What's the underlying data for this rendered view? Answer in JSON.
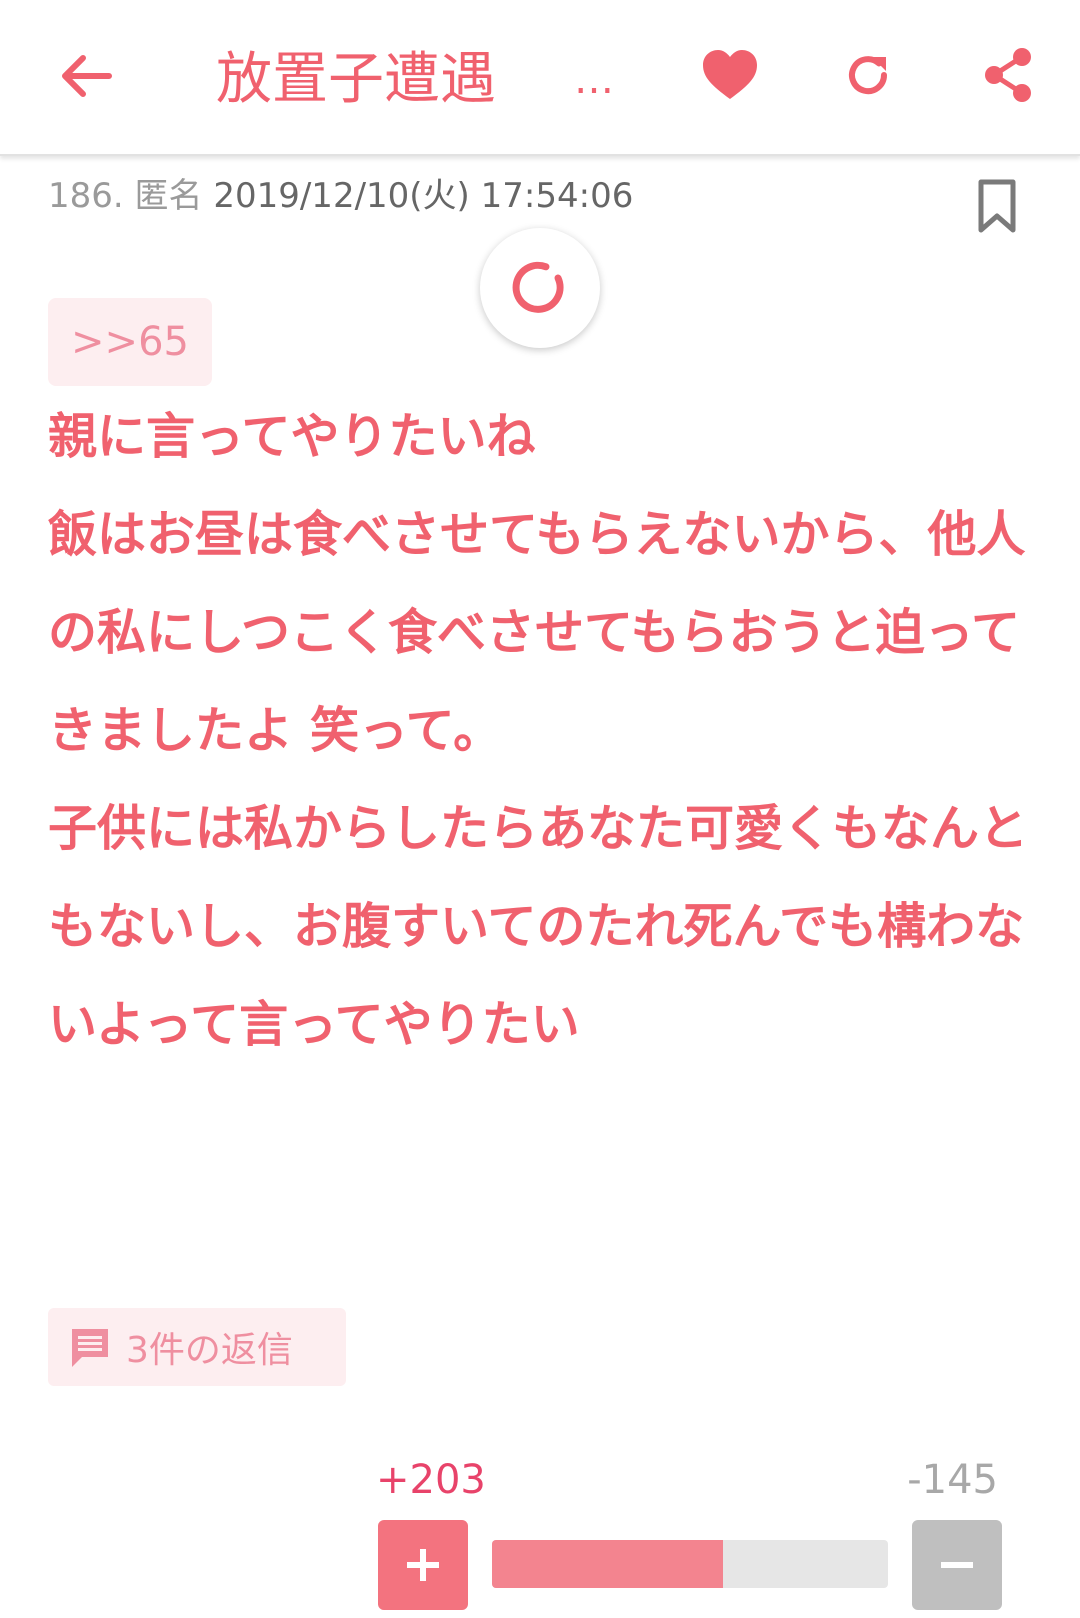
{
  "header": {
    "title": "放置子遭遇",
    "title_overflow": "…",
    "icons": [
      "arrow-left-icon",
      "heart-icon",
      "refresh-icon",
      "share-icon"
    ]
  },
  "post": {
    "number": "186.",
    "author": "匿名",
    "datetime": "2019/12/10(火) 17:54:06",
    "anchor": ">>65",
    "body": "親に言ってやりたいね\n飯はお昼は食べさせてもらえないから、他人の私にしつこく食べさせてもらおうと迫ってきましたよ 笑って。\n子供には私からしたらあなた可愛くもなんともないし、お腹すいてのたれ死んでも構わないよって言ってやりたい",
    "reply_label": "3件の返信",
    "votes": {
      "plus": "+203",
      "minus": "-145",
      "plus_fraction": 0.583
    }
  },
  "colors": {
    "accent": "#f0616e",
    "chip_bg": "#fdeef0",
    "plus_button": "#f3737f",
    "minus_button": "#bfbfbf"
  }
}
